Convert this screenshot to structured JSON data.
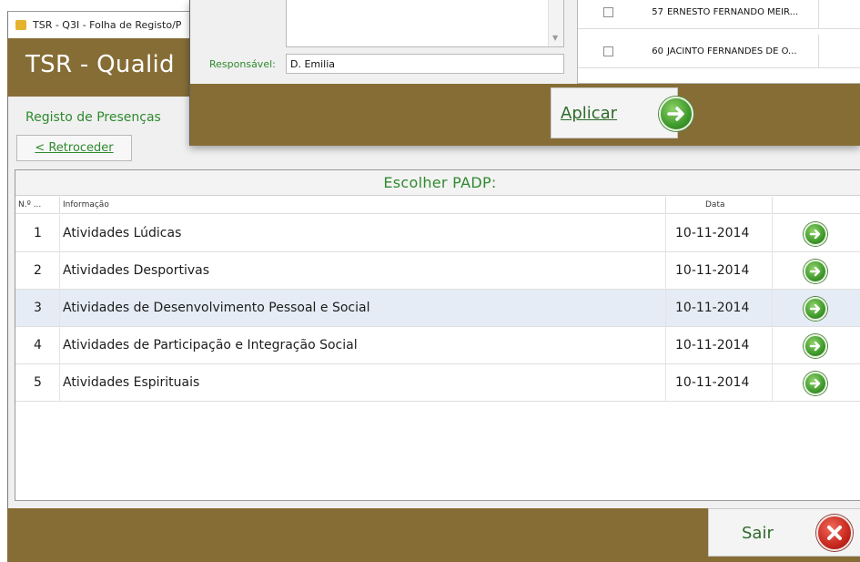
{
  "window": {
    "title": "TSR - Q3I - Folha de Registo/P",
    "brand": "TSR - Qualid",
    "subheading": "Registo de Presenças",
    "back_label": "< Retroceder"
  },
  "list": {
    "heading": "Escolher PADP:",
    "columns": {
      "num": "N.º ...",
      "info": "Informação",
      "date": "Data"
    },
    "rows": [
      {
        "num": "1",
        "info": "Atividades Lúdicas",
        "date": "10-11-2014",
        "selected": false
      },
      {
        "num": "2",
        "info": "Atividades Desportivas",
        "date": "10-11-2014",
        "selected": false
      },
      {
        "num": "3",
        "info": "Atividades de Desenvolvimento Pessoal e Social",
        "date": "10-11-2014",
        "selected": true
      },
      {
        "num": "4",
        "info": "Atividades de Participação e Integração Social",
        "date": "10-11-2014",
        "selected": false
      },
      {
        "num": "5",
        "info": "Atividades Espirituais",
        "date": "10-11-2014",
        "selected": false
      }
    ],
    "row_icon": "arrow-right-circle-icon"
  },
  "footer": {
    "exit_label": "Sair",
    "exit_icon": "close-circle-icon"
  },
  "dialog": {
    "responsible_label": "Responsável:",
    "responsible_value": "D. Emilia",
    "people": [
      {
        "num": "57",
        "name": "ERNESTO FERNANDO MEIR..."
      },
      {
        "num": "60",
        "name": "JACINTO FERNANDES DE O..."
      }
    ],
    "apply_label": "Aplicar",
    "apply_icon": "arrow-right-circle-icon"
  },
  "colors": {
    "brand_bar": "#866d36",
    "accent_green": "#2f8a2f",
    "selected_row": "#e6ecf5"
  }
}
